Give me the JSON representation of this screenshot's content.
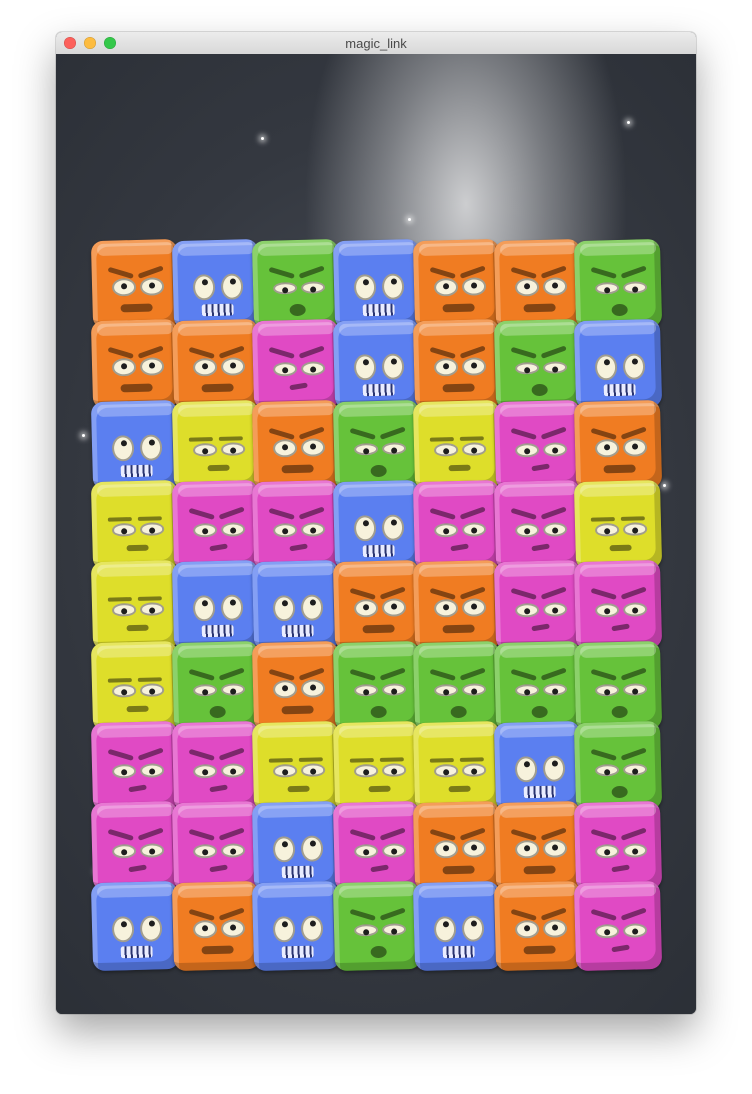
{
  "window": {
    "title": "magic_link",
    "buttons": [
      "close",
      "minimize",
      "zoom"
    ]
  },
  "colors": {
    "orange": "#f07c22",
    "blue": "#5b7ff0",
    "green": "#66c23a",
    "magenta": "#e04ac4",
    "yellow": "#dede2a",
    "traffic_close": "#fc605b",
    "traffic_minimize": "#fdbc40",
    "traffic_zoom": "#34c84a"
  },
  "board": {
    "columns": 7,
    "rows": 9,
    "grid": [
      [
        "orange",
        "blue",
        "green",
        "blue",
        "orange",
        "orange",
        "green"
      ],
      [
        "orange",
        "orange",
        "magenta",
        "blue",
        "orange",
        "green",
        "blue"
      ],
      [
        "blue",
        "yellow",
        "orange",
        "green",
        "yellow",
        "magenta",
        "orange"
      ],
      [
        "yellow",
        "magenta",
        "magenta",
        "blue",
        "magenta",
        "magenta",
        "yellow"
      ],
      [
        "yellow",
        "blue",
        "blue",
        "orange",
        "orange",
        "magenta",
        "magenta"
      ],
      [
        "yellow",
        "green",
        "orange",
        "green",
        "green",
        "green",
        "green"
      ],
      [
        "magenta",
        "magenta",
        "yellow",
        "yellow",
        "yellow",
        "blue",
        "green"
      ],
      [
        "magenta",
        "magenta",
        "blue",
        "magenta",
        "orange",
        "orange",
        "magenta"
      ],
      [
        "blue",
        "orange",
        "blue",
        "green",
        "blue",
        "orange",
        "magenta"
      ]
    ]
  }
}
